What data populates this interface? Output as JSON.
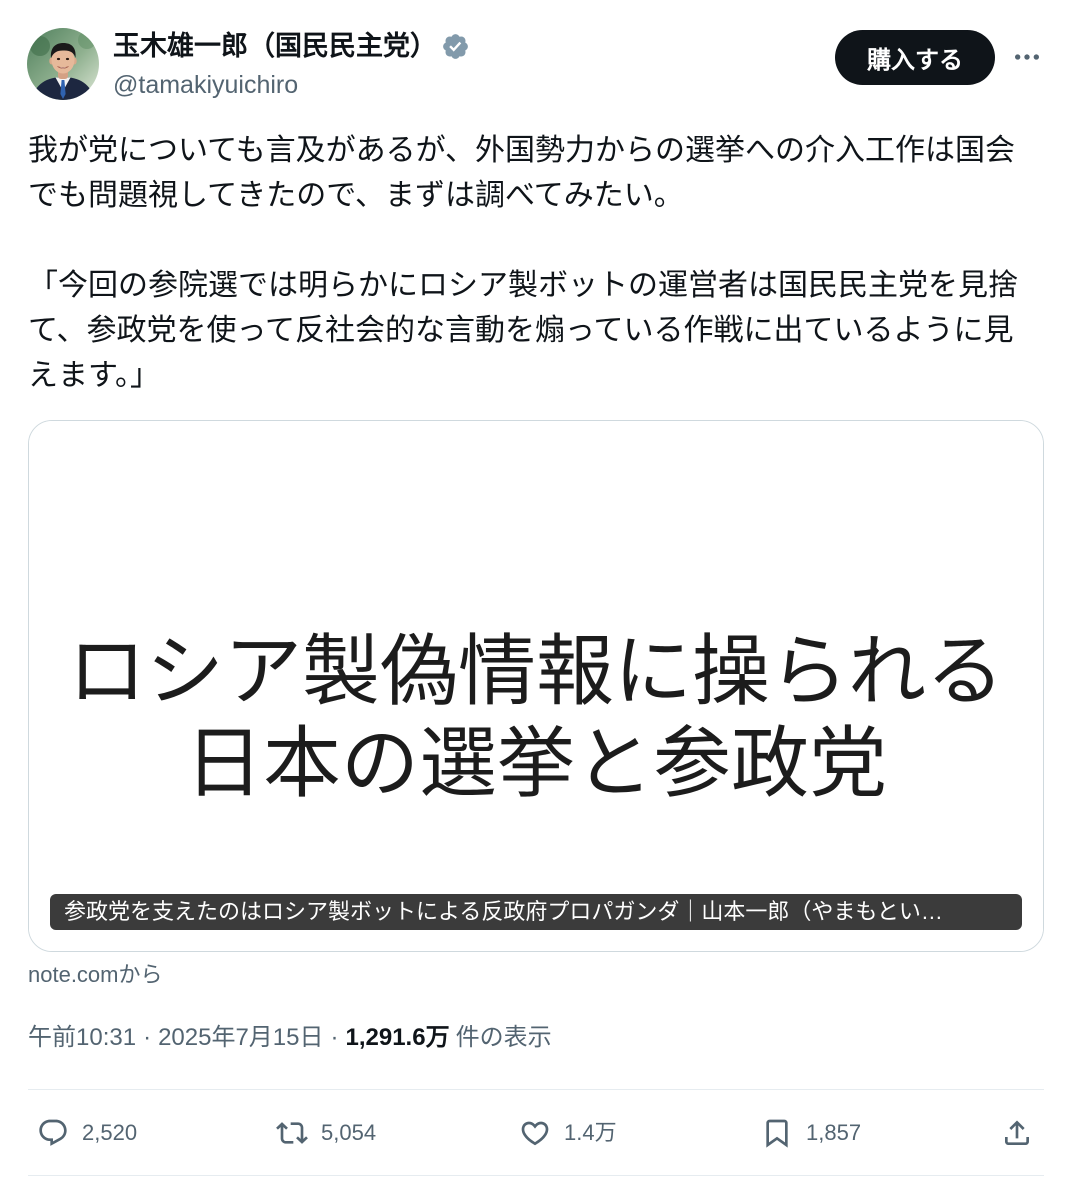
{
  "author": {
    "display_name": "玉木雄一郎（国民民主党）",
    "handle": "@tamakiyuichiro",
    "badge_icon": "verified-badge-icon"
  },
  "header": {
    "buy_button_label": "購入する",
    "more_icon": "more-horizontal-icon"
  },
  "tweet": {
    "lines": [
      "我が党についても言及があるが、外国勢力からの選挙への介入工作は国会",
      "でも問題視してきたので、まずは調べてみたい。",
      "「今回の参院選では明らかにロシア製ボットの運営者は国民民主党を見捨",
      "て、参政党を使って反社会的な言動を煽っている作戦に出ているように見",
      "えます。」"
    ]
  },
  "card": {
    "image_text_lines": [
      "ロシア製偽情報に操られる",
      "日本の選挙と参政党"
    ],
    "title": "参政党を支えたのはロシア製ボットによる反政府プロパガンダ｜山本一郎（やまもとい…",
    "source": "note.comから"
  },
  "meta": {
    "time": "午前10:31",
    "separator": "·",
    "date": "2025年7月15日",
    "views_count": "1,291.6万",
    "views_label": "件の表示"
  },
  "actions": {
    "reply": {
      "icon": "reply-icon",
      "count": "2,520"
    },
    "retweet": {
      "icon": "retweet-icon",
      "count": "5,054"
    },
    "like": {
      "icon": "heart-icon",
      "count": "1.4万"
    },
    "bookmark": {
      "icon": "bookmark-icon",
      "count": "1,857"
    },
    "share": {
      "icon": "share-icon"
    }
  },
  "colors": {
    "text_primary": "#0f1419",
    "text_secondary": "#536471",
    "border": "#cfd9de",
    "divider": "#e6ecf0",
    "button_bg": "#0f1419",
    "button_text": "#ffffff",
    "badge": "#829aab",
    "card_title_bg": "rgba(0,0,0,0.77)"
  }
}
